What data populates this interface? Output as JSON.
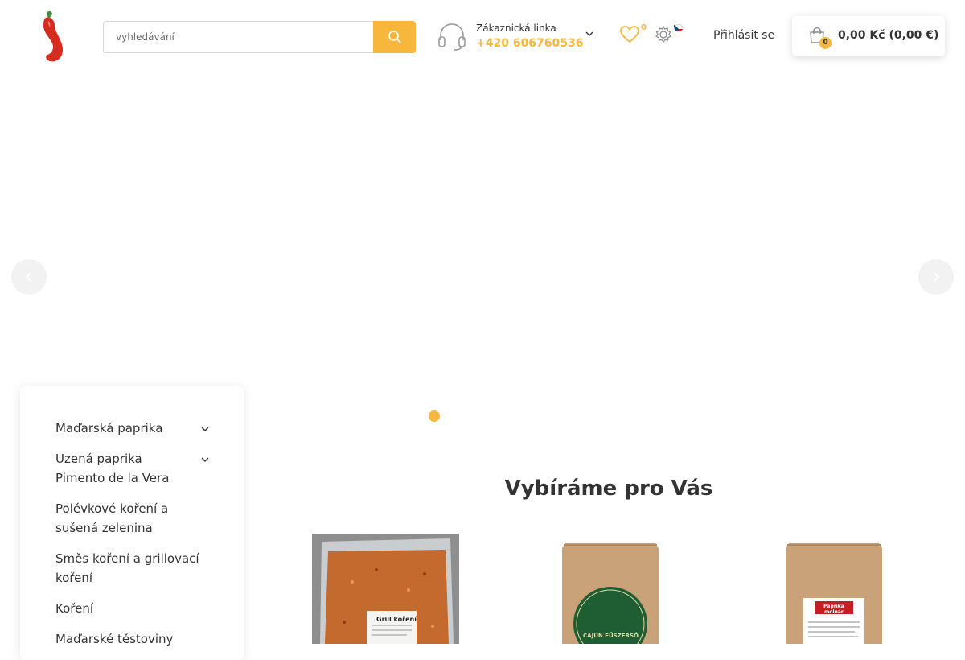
{
  "header": {
    "logo_icon": "chili-pepper-logo",
    "search": {
      "placeholder": "vyhledávání",
      "value": "",
      "icon": "search-icon"
    },
    "support": {
      "label": "Zákaznická linka",
      "phone": "+420 606760536",
      "icon": "headset-icon"
    },
    "wishlist": {
      "count": "0",
      "icon": "heart-icon"
    },
    "settings_icon": "gear-icon",
    "language_icon": "czech-flag-icon",
    "login_label": "Přihlásit se",
    "cart": {
      "count": "0",
      "total": "0,00 Kč (0,00 €)",
      "icon": "shopping-bag-icon"
    }
  },
  "slider": {
    "prev_icon": "chevron-left-icon",
    "next_icon": "chevron-right-icon",
    "dots": 1,
    "active_dot": 1
  },
  "sidebar": {
    "items": [
      {
        "label": "Maďarská paprika",
        "has_submenu": true
      },
      {
        "label": "Uzená paprika Pimento de la Vera",
        "has_submenu": true
      },
      {
        "label": "Polévkové koření a sušená zelenina",
        "has_submenu": false
      },
      {
        "label": "Směs koření a grillovací koření",
        "has_submenu": false
      },
      {
        "label": "Koření",
        "has_submenu": false
      },
      {
        "label": "Maďarské těstoviny",
        "has_submenu": false
      }
    ]
  },
  "section": {
    "title": "Vybíráme pro Vás"
  },
  "products": [
    {
      "name": "grill-koreni-product-image",
      "label": "Grill koření"
    },
    {
      "name": "cajun-fuszerso-product-image",
      "label": "CAJUN FŰSZERSÓ"
    },
    {
      "name": "paprika-molnar-product-image",
      "label": "Paprika molnár"
    }
  ],
  "colors": {
    "accent": "#f6b73c",
    "text": "#333333",
    "logo_red": "#d62b1f",
    "logo_green": "#3f8f3a"
  }
}
